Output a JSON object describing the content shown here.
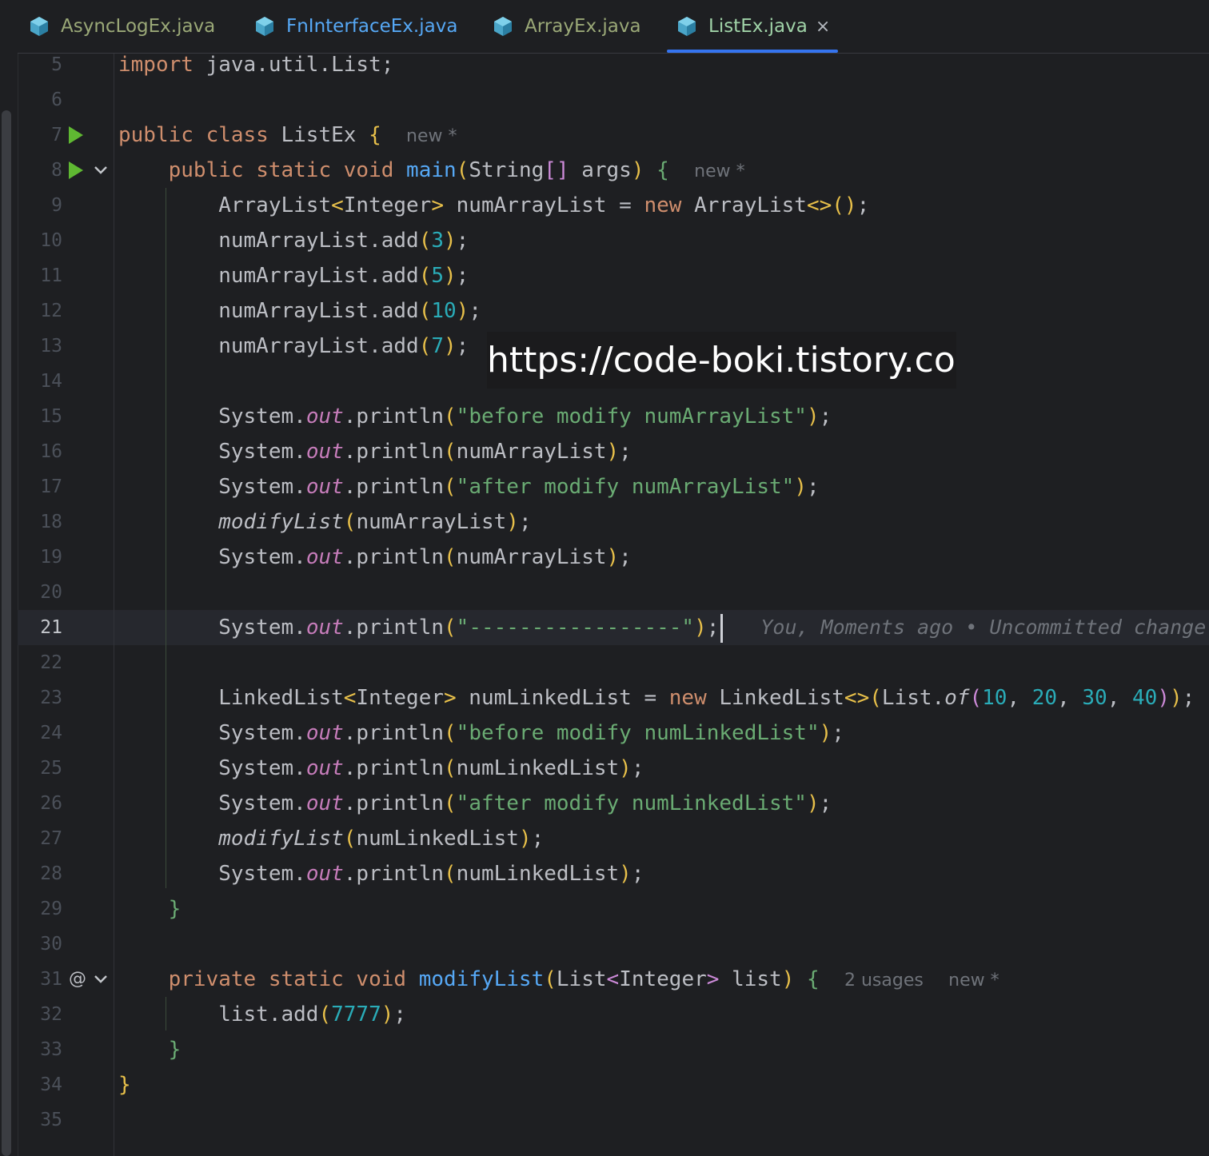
{
  "tabs": [
    {
      "label": "AsyncLogEx.java",
      "active": false
    },
    {
      "label": "FnInterfaceEx.java",
      "active": false
    },
    {
      "label": "ArrayEx.java",
      "active": false
    },
    {
      "label": "ListEx.java",
      "active": true
    }
  ],
  "close_glyph": "×",
  "current_line": 21,
  "hints": {
    "new_label": "new *",
    "usages_label": "2 usages",
    "blame": "You, Moments ago • Uncommitted change"
  },
  "watermark": "https://code-boki.tistory.com",
  "lines": [
    {
      "n": "5",
      "code": "import java.util.List;"
    },
    {
      "n": "6",
      "code": ""
    },
    {
      "n": "7",
      "code": "public class ListEx {"
    },
    {
      "n": "8",
      "code": "public static void main(String[] args) {"
    },
    {
      "n": "9",
      "code": "ArrayList<Integer> numArrayList = new ArrayList<>();"
    },
    {
      "n": "10",
      "code": "numArrayList.add(3);"
    },
    {
      "n": "11",
      "code": "numArrayList.add(5);"
    },
    {
      "n": "12",
      "code": "numArrayList.add(10);"
    },
    {
      "n": "13",
      "code": "numArrayList.add(7);"
    },
    {
      "n": "14",
      "code": ""
    },
    {
      "n": "15",
      "code": "System.out.println(\"before modify numArrayList\");"
    },
    {
      "n": "16",
      "code": "System.out.println(numArrayList);"
    },
    {
      "n": "17",
      "code": "System.out.println(\"after modify numArrayList\");"
    },
    {
      "n": "18",
      "code": "modifyList(numArrayList);"
    },
    {
      "n": "19",
      "code": "System.out.println(numArrayList);"
    },
    {
      "n": "20",
      "code": ""
    },
    {
      "n": "21",
      "code": "System.out.println(\"-----------------\");"
    },
    {
      "n": "22",
      "code": ""
    },
    {
      "n": "23",
      "code": "LinkedList<Integer> numLinkedList = new LinkedList<>(List.of(10, 20, 30, 40));"
    },
    {
      "n": "24",
      "code": "System.out.println(\"before modify numLinkedList\");"
    },
    {
      "n": "25",
      "code": "System.out.println(numLinkedList);"
    },
    {
      "n": "26",
      "code": "System.out.println(\"after modify numLinkedList\");"
    },
    {
      "n": "27",
      "code": "modifyList(numLinkedList);"
    },
    {
      "n": "28",
      "code": "System.out.println(numLinkedList);"
    },
    {
      "n": "29",
      "code": "}"
    },
    {
      "n": "30",
      "code": ""
    },
    {
      "n": "31",
      "code": "private static void modifyList(List<Integer> list) {"
    },
    {
      "n": "32",
      "code": "list.add(7777);"
    },
    {
      "n": "33",
      "code": "}"
    },
    {
      "n": "34",
      "code": "}"
    },
    {
      "n": "35",
      "code": ""
    }
  ],
  "colors": {
    "background": "#1e1f22",
    "keyword": "#cf8e6d",
    "method": "#56a8f5",
    "number": "#2aacb8",
    "string": "#6aab73",
    "static_field": "#c77dbb",
    "tab_underline": "#3574f0"
  },
  "icons": {
    "tab_file": "java-class-file-icon",
    "run": "run-gutter-icon",
    "fold": "chevron-down-icon",
    "override": "at-sign-icon",
    "close": "close-icon"
  }
}
